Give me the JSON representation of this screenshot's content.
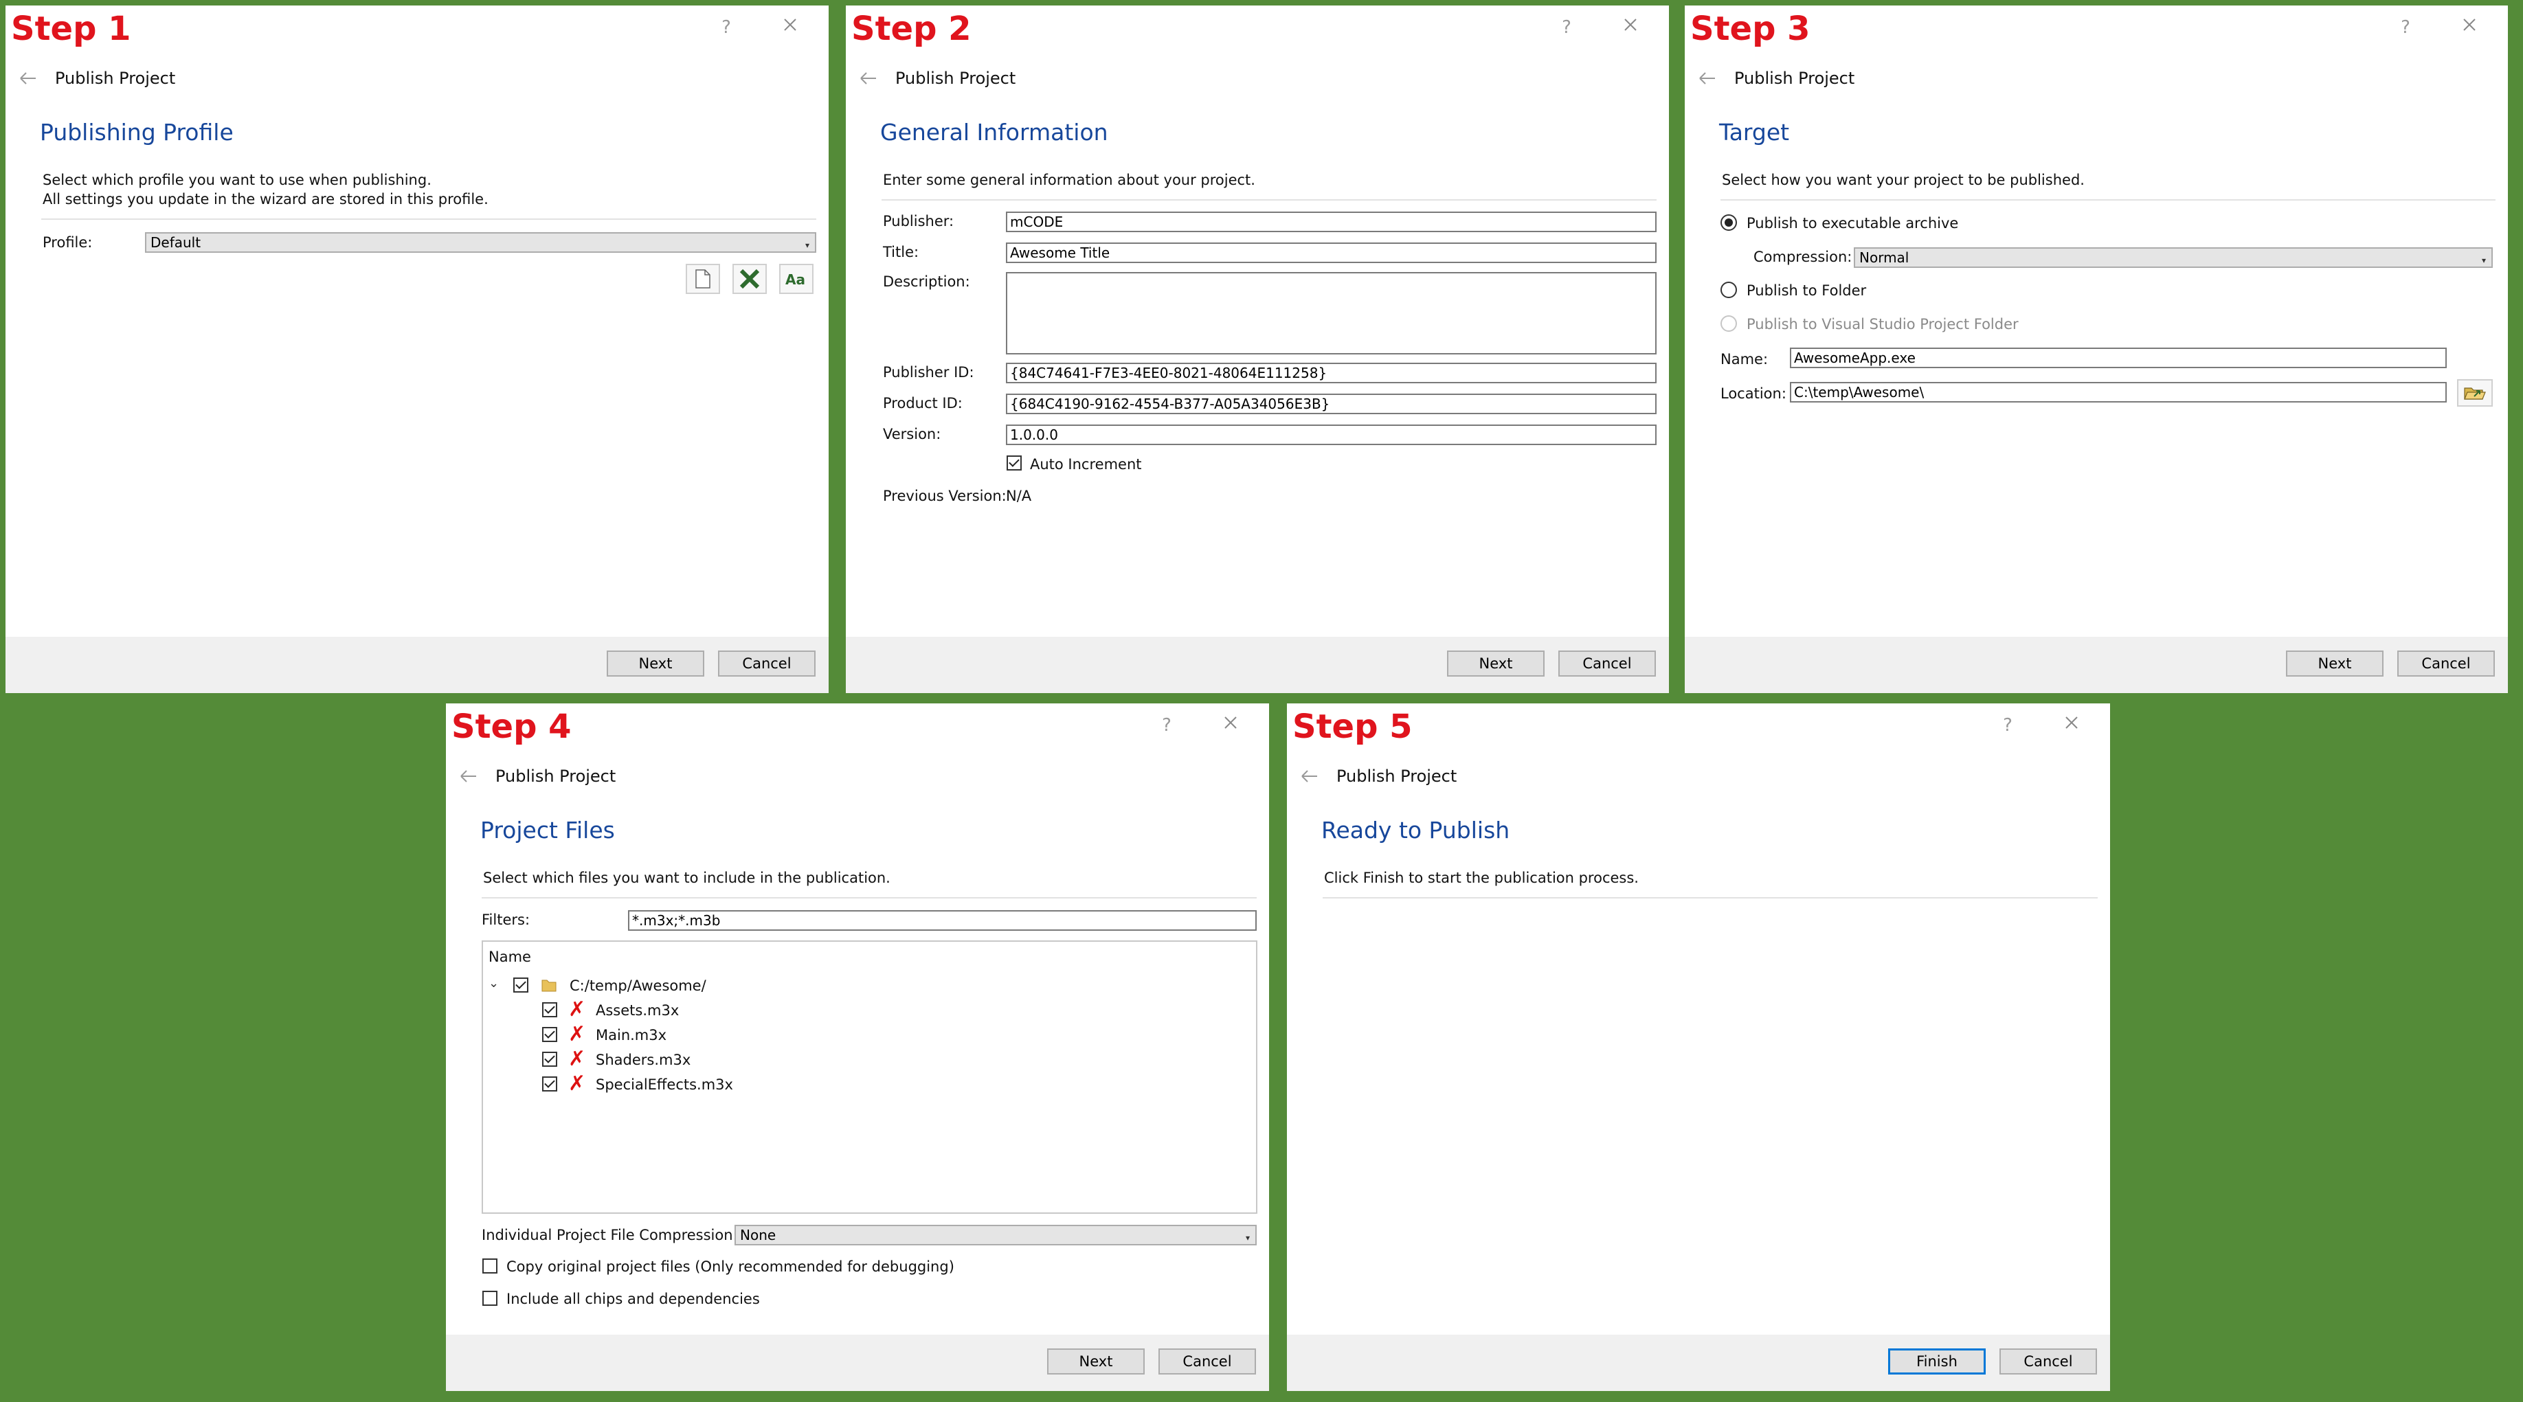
{
  "common": {
    "nav_title": "Publish Project",
    "help": "?",
    "next_label": "Next",
    "cancel_label": "Cancel",
    "finish_label": "Finish"
  },
  "step1": {
    "label": "Step 1",
    "heading": "Publishing Profile",
    "sub_line1": "Select which profile you want to use when publishing.",
    "sub_line2": "All settings you update in the wizard are stored in this profile.",
    "profile_label": "Profile:",
    "profile_value": "Default",
    "tools": [
      "new-profile-icon",
      "delete-profile-icon",
      "rename-profile-icon"
    ]
  },
  "step2": {
    "label": "Step 2",
    "heading": "General Information",
    "sub": "Enter some general information about your project.",
    "publisher_label": "Publisher:",
    "publisher_value": "mCODE",
    "title_label": "Title:",
    "title_value": "Awesome Title",
    "description_label": "Description:",
    "description_value": "",
    "publisher_id_label": "Publisher ID:",
    "publisher_id_value": "{84C74641-F7E3-4EE0-8021-48064E111258}",
    "product_id_label": "Product ID:",
    "product_id_value": "{684C4190-9162-4554-B377-A05A34056E3B}",
    "version_label": "Version:",
    "version_value": "1.0.0.0",
    "auto_increment_label": "Auto Increment",
    "auto_increment_checked": true,
    "previous_version_label": "Previous Version:",
    "previous_version_value": "N/A"
  },
  "step3": {
    "label": "Step 3",
    "heading": "Target",
    "sub": "Select how you want your project to be published.",
    "option_archive": "Publish to executable archive",
    "compression_label": "Compression:",
    "compression_value": "Normal",
    "option_folder": "Publish to Folder",
    "option_vs": "Publish to Visual Studio Project Folder",
    "name_label": "Name:",
    "name_value": "AwesomeApp.exe",
    "location_label": "Location:",
    "location_value": "C:\\temp\\Awesome\\",
    "selected_option": "archive"
  },
  "step4": {
    "label": "Step 4",
    "heading": "Project Files",
    "sub": "Select which files you want to include in the publication.",
    "filters_label": "Filters:",
    "filters_value": "*.m3x;*.m3b",
    "tree_header": "Name",
    "root_folder": "C:/temp/Awesome/",
    "files": [
      "Assets.m3x",
      "Main.m3x",
      "Shaders.m3x",
      "SpecialEffects.m3x"
    ],
    "compression_label": "Individual Project File Compression:",
    "compression_value": "None",
    "copy_original_label": "Copy original project files (Only recommended for debugging)",
    "include_chips_label": "Include all chips and dependencies"
  },
  "step5": {
    "label": "Step 5",
    "heading": "Ready to Publish",
    "sub": "Click Finish to start the publication process."
  },
  "colors": {
    "background": "#548b38",
    "step_label": "#e0141d",
    "heading": "#17479b",
    "delete_x": "#d11111"
  }
}
